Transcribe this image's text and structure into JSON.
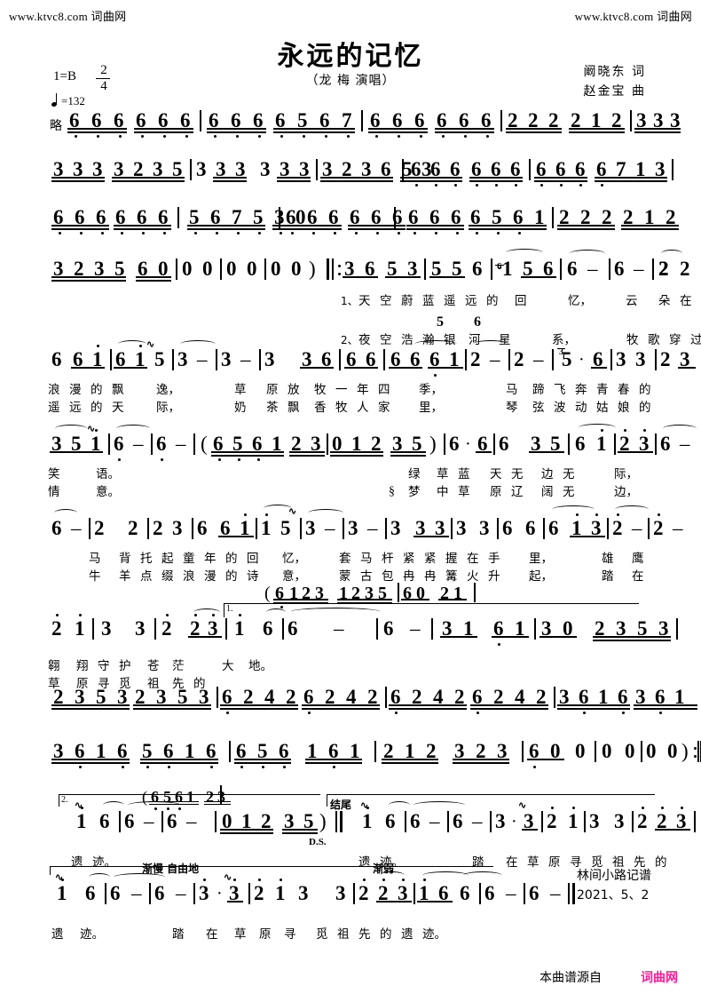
{
  "watermark": {
    "left": "www.ktvc8.com 词曲网",
    "right": "www.ktvc8.com 词曲网"
  },
  "header": {
    "title": "永远的记忆",
    "singer": "（龙 梅 演唱）",
    "lyricist": "阚晓东 词",
    "composer": "赵金宝 曲",
    "key_signature": "1=B",
    "meter_num": "2",
    "meter_den": "4",
    "tempo": "=132",
    "intro_label": "略"
  },
  "footer": {
    "transcriber": "林间小路记谱",
    "date": "2021、5、2",
    "source_prefix": "本曲谱源自",
    "source_site": "词曲网"
  },
  "marks": {
    "ending1": "1.",
    "ending2": "2.",
    "coda_label": "结尾",
    "ds": "D.S.",
    "rit": "渐慢 自由地",
    "dim": "渐弱",
    "verse1": "1、",
    "verse2": "2、"
  },
  "chart_data": {
    "type": "table",
    "title": "永远的记忆 — 简谱 (numbered musical notation)",
    "systems": [
      {
        "id": 1,
        "notes": "略 6 6 6 6 6 6 | 6 6 6 6 5 6 7 | 6 6 6 6 6 6 | 2 2 2 2 1 2 | 3 3 3 3 3 3 |",
        "lyrics": []
      },
      {
        "id": 2,
        "notes": "3 3 3 3 2 3 5 | 3 3 3 3 3 3 | 3 2 3 6 5 3 | 6 6 6 6 6 6 | 6 6 6 6 7 1 3 |",
        "lyrics": []
      },
      {
        "id": 3,
        "notes": "6 6 6 6 6 6 | 5 6 7 5 3 0 | 6 6 6 6 6 6 | 6 6 6 6 5 6 1 | 2 2 2 2 1 2 |",
        "lyrics": []
      },
      {
        "id": 4,
        "notes": "3 2 3 5 6 0 | 0 0 | 0 0 | 0 0 ) ‖: 3 6 5 3 | 5 5 6 | (6)1 5 6 | 6 - | 6 - | 2 2 1 6 |",
        "lyrics": [
          "1、天 空 蔚 蓝 遥 远 的  回      忆，      云   朵 在",
          "2、夜 空 浩 瀚 银  河   星      系，          牧 歌 穿 过"
        ],
        "extra": "5 6"
      },
      {
        "id": 5,
        "notes": "6 6 1 | 6 1 5 | 3 - | 3 - | 3  3 6 | 6 6 6 | 6 1 | 2 - | 2 - | 5· 6 | 3 3 | 2 3 5 |",
        "lyrics": [
          "浪 漫 的 飘     逸，     草  原 放  牧 一 年 四     季，      马  蹄 飞 奔 青 春 的",
          "遥 远 的 天     际，     奶  茶 飘  香 牧 人 家     里，      琴  弦 波 动 姑 娘 的"
        ]
      },
      {
        "id": 6,
        "notes": "3 5 1 | 6 - | 6 - | ( 6 5 6 1 2 3 | 0 1 2 3 5 ) | 6· 6 6  3 5  6 1 | 2 3 | 6 - |",
        "lyrics": [
          "笑     语。                              绿  草 蓝  天 无  边 无      际，",
          "情     意。                            ℅梦  中 草  原 辽  阔 无      边，"
        ]
      },
      {
        "id": 7,
        "notes": "6 - | 2  2 | 2 3 | 6 6 1 | 1 5 | 3 - | 3 - | 3 3 3 | 3 3 | 6 6 | 6 1 3 | 2 - | 2 - | 3· 3 |",
        "lyrics": [
          "马  背 托 起 童 年 的 回   忆，       套 马 杆 紧 紧 握 在 手      里，       雄   鹰",
          "牛  羊 点 缀 浪 漫 的 诗   意，       蒙 古 包 冉 冉 篝 火 升      起，       踏   在"
        ],
        "interlude": "( 6123 1235 | 60 21 |"
      },
      {
        "id": 8,
        "notes": "2 1 | 3 3 | 2 2 3 | 1 6 | 6  -  | 6 - | 3 1  6 1 | 3 0  2 3 5 3 |",
        "lyrics": [
          "翱 翔 守 护 苍 茫   大 地。",
          "草 原 寻 觅 祖 先 的"
        ]
      },
      {
        "id": 9,
        "notes": "2 3 5 3  2 3 5 3 | 6 2 4 2  6 2 4 2 | 6 2 4 2  6 2 4 2 | 3 6 1 6  3 6 1 6 |",
        "lyrics": []
      },
      {
        "id": 10,
        "notes": "3 6 1 6  5 6 1 6 | 6 5 6  1 6 1 | 2 1 2  3 2 3 | 6 0  0 | 0 0 | 0 0 ) :‖",
        "lyrics": []
      },
      {
        "id": 11,
        "notes": "[2.] 1 6 | 6 - | 6 - |  ( 6561 23 |  0 1 2  3 5 ) ‖   D.S.    [结尾] 1 6 | 6 - | 6 - | 3· 3 | 2 1 | 3 3 | 2 2 3 |",
        "lyrics": [
          "遗 迹。",
          "遗 迹。      踏  在 草 原 寻 觅 祖 先 的"
        ]
      },
      {
        "id": 12,
        "notes": "1  6 | 6 - | 6 - | 3· 3 | 2 1 | 3   3 | 2 2 3 | 1 6  6 | 6 - | 6 - ‖",
        "lyrics": [
          "遗  迹。      踏  在  草 原 寻  觅 祖 先 的 遗 迹。"
        ]
      }
    ]
  }
}
